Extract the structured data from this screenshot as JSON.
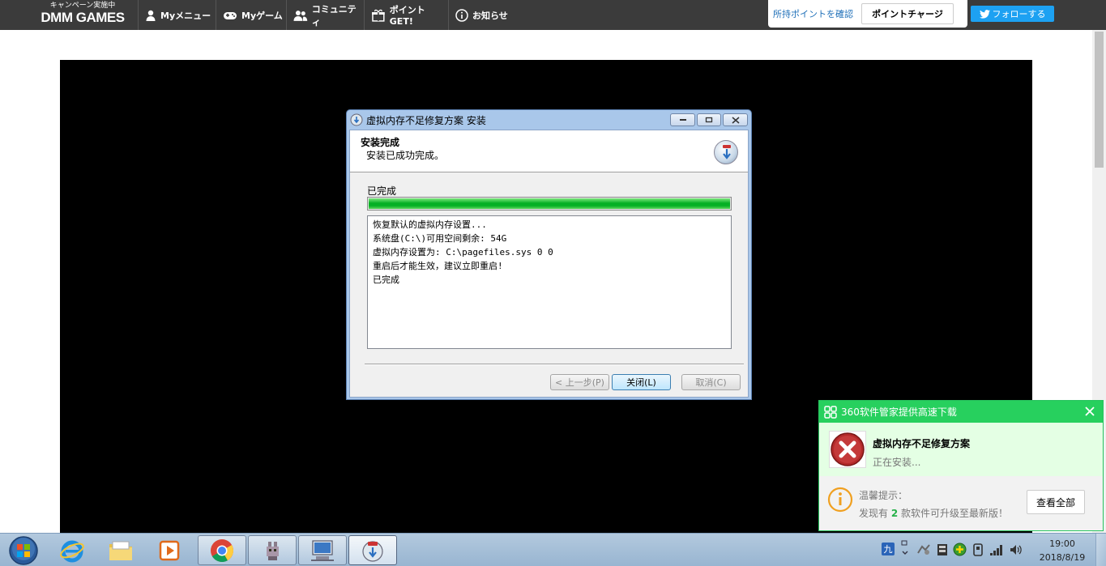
{
  "topnav": {
    "logo_top": "キャンペーン実施中",
    "logo_main": "DMM GAMES",
    "items": [
      {
        "label": "Myメニュー",
        "icon": "person-icon"
      },
      {
        "label": "Myゲーム",
        "icon": "gamepad-icon"
      },
      {
        "label": "コミュニティ",
        "icon": "people-icon"
      },
      {
        "label": "ポイントGET!",
        "icon": "gift-icon"
      },
      {
        "label": "お知らせ",
        "icon": "info-icon"
      }
    ],
    "point_link": "所持ポイントを確認",
    "charge_button": "ポイントチャージ",
    "follow_button": "フォローする"
  },
  "dialog": {
    "title": "虚拟内存不足修复方案 安装",
    "header_title": "安装完成",
    "header_subtitle": "安装已成功完成。",
    "progress_label": "已完成",
    "progress_value": 1.0,
    "log_lines": [
      "恢复默认的虚拟内存设置...",
      "系统盘(C:\\)可用空间剩余: 54G",
      "虚拟内存设置为: C:\\pagefiles.sys 0 0",
      "重启后才能生效，建议立即重启!",
      "已完成"
    ],
    "back_button": "< 上一步(P)",
    "close_button": "关闭(L)",
    "cancel_button": "取消(C)"
  },
  "popup": {
    "title": "360软件管家提供高速下载",
    "app_name": "虚拟内存不足修复方案",
    "status": "正在安装...",
    "tip_title": "温馨提示：",
    "tip_prefix": "发现有",
    "tip_count": "2",
    "tip_suffix": "款软件可升级至最新版！",
    "view_all_button": "查看全部",
    "accent_color": "#27d05e"
  },
  "taskbar": {
    "tray_ime": "九",
    "time": "19:00",
    "date": "2018/8/19"
  }
}
